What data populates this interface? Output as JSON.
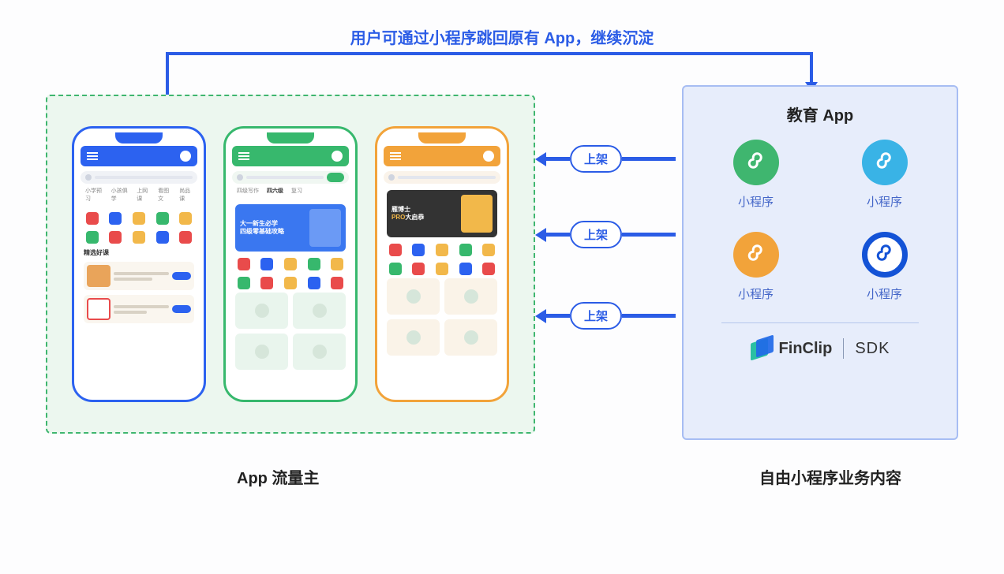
{
  "top_flow_label": "用户可通过小程序跳回原有 App，继续沉淀",
  "publish_labels": [
    "上架",
    "上架",
    "上架"
  ],
  "left_section": {
    "title": "App 流量主",
    "phones": {
      "blue": {
        "section_title": "精选好课",
        "tabs": [
          "小学预习",
          "小孩俱学",
          "上网课",
          "看图文",
          "尚品课"
        ]
      },
      "green": {
        "tab_active": "四六级",
        "banner_line1": "大一新生必学",
        "banner_line2": "四级零基础攻略"
      },
      "orange": {
        "banner_brand": "雁博士",
        "banner_pro": "PRO",
        "banner_tail": "大启恭"
      }
    }
  },
  "right_section": {
    "title": "教育 App",
    "miniprogram_label": "小程序",
    "sdk_brand": "FinClip",
    "sdk_text": "SDK",
    "footer": "自由小程序业务内容"
  }
}
